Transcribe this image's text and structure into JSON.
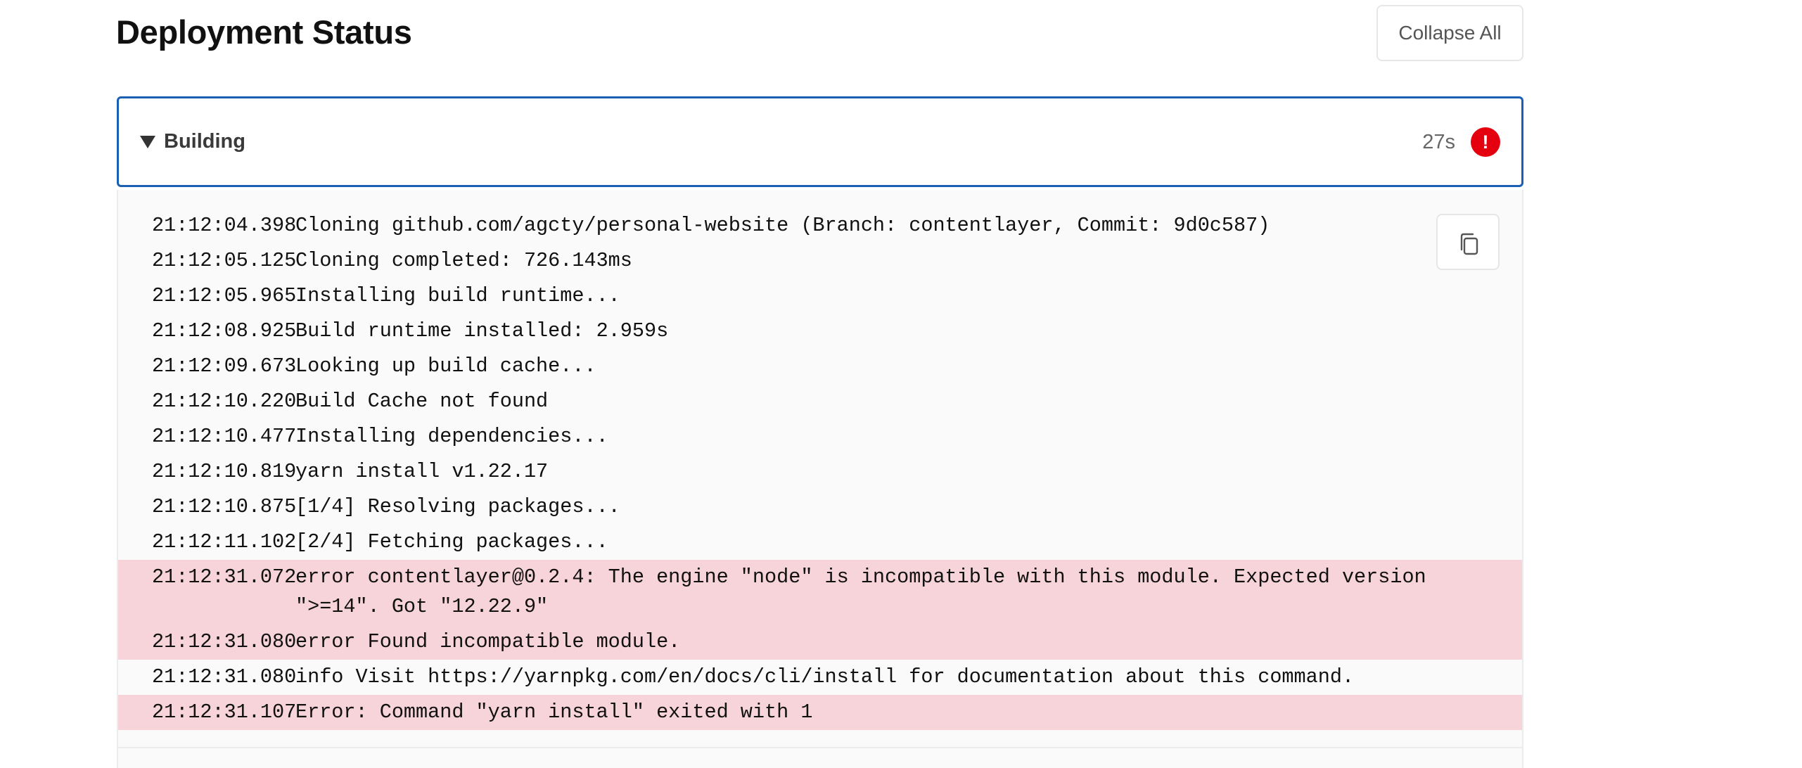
{
  "header": {
    "title": "Deployment Status",
    "collapse_label": "Collapse All"
  },
  "panel": {
    "label": "Building",
    "duration": "27s",
    "badge": "!",
    "expanded": true,
    "error_color": "#e5000f",
    "accent_color": "#1a5fb4",
    "error_row_color": "#f7d4d9"
  },
  "log": {
    "lines": [
      {
        "time": "21:12:04.398",
        "message": "Cloning github.com/agcty/personal-website (Branch: contentlayer, Commit: 9d0c587)",
        "level": "info"
      },
      {
        "time": "21:12:05.125",
        "message": "Cloning completed: 726.143ms",
        "level": "info"
      },
      {
        "time": "21:12:05.965",
        "message": "Installing build runtime...",
        "level": "info"
      },
      {
        "time": "21:12:08.925",
        "message": "Build runtime installed: 2.959s",
        "level": "info"
      },
      {
        "time": "21:12:09.673",
        "message": "Looking up build cache...",
        "level": "info"
      },
      {
        "time": "21:12:10.220",
        "message": "Build Cache not found",
        "level": "info"
      },
      {
        "time": "21:12:10.477",
        "message": "Installing dependencies...",
        "level": "info"
      },
      {
        "time": "21:12:10.819",
        "message": "yarn install v1.22.17",
        "level": "info"
      },
      {
        "time": "21:12:10.875",
        "message": "[1/4] Resolving packages...",
        "level": "info"
      },
      {
        "time": "21:12:11.102",
        "message": "[2/4] Fetching packages...",
        "level": "info"
      },
      {
        "time": "21:12:31.072",
        "message": "error contentlayer@0.2.4: The engine \"node\" is incompatible with this module. Expected version \">=14\". Got \"12.22.9\"",
        "level": "error"
      },
      {
        "time": "21:12:31.080",
        "message": "error Found incompatible module.",
        "level": "error"
      },
      {
        "time": "21:12:31.080",
        "message": "info Visit https://yarnpkg.com/en/docs/cli/install for documentation about this command.",
        "level": "info"
      },
      {
        "time": "21:12:31.107",
        "message": "Error: Command \"yarn install\" exited with 1",
        "level": "error"
      }
    ],
    "copy_icon": "copy-icon"
  }
}
